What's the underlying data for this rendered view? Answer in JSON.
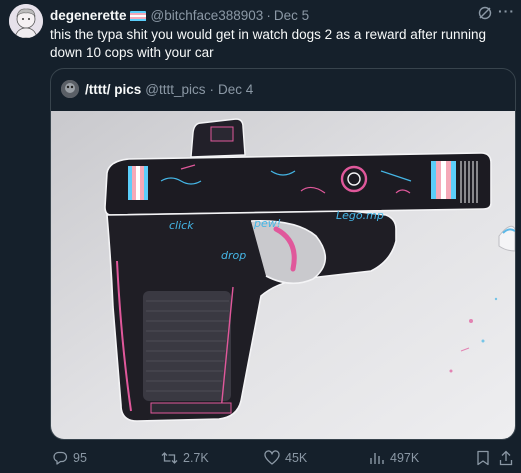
{
  "tweet": {
    "author_name": "degenerette",
    "handle": "@bitchface388903",
    "separator": "·",
    "date": "Dec 5",
    "text": "this the typa shit you would get in watch dogs 2 as a reward after running down 10 cops with your car",
    "more_label": "···"
  },
  "quote": {
    "author_name": "/tttt/ pics",
    "handle": "@tttt_pics",
    "separator": "·",
    "date": "Dec 4",
    "image_texts": [
      "click",
      "pew!",
      "Lego.mp",
      "drop"
    ]
  },
  "actions": {
    "replies": "95",
    "reposts": "2.7K",
    "likes": "45K",
    "views": "497K"
  },
  "colors": {
    "background": "#15202b",
    "muted_text": "#8b98a5",
    "border": "#38444d",
    "flag_blue": "#5bcefa",
    "flag_pink": "#f5a9b8",
    "flag_white": "#ffffff"
  },
  "icons": [
    "reply-icon",
    "repost-icon",
    "like-icon",
    "views-icon",
    "bookmark-icon",
    "share-icon",
    "grok-icon",
    "more-icon"
  ]
}
